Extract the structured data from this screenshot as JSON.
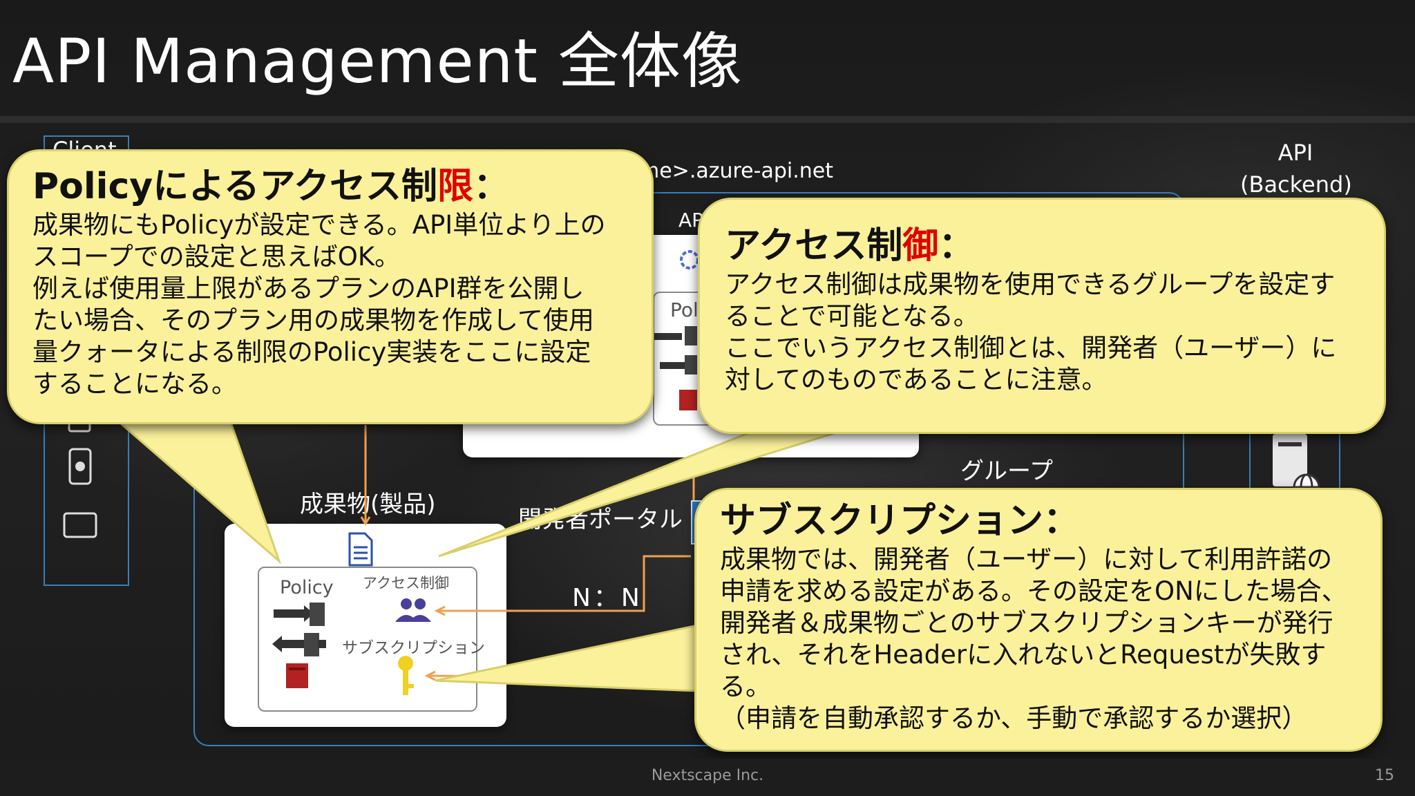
{
  "slide": {
    "title": "API Management 全体像",
    "footer": "Nextscape Inc.",
    "page_number": "15"
  },
  "diagram": {
    "client_label": "Client",
    "url_label": "me>.azure-api.net",
    "api_backend_label": "API\n(Backend)",
    "product_label": "成果物(製品)",
    "policy_label": "Policy",
    "access_control_label": "アクセス制御",
    "subscription_label": "サブスクリプション",
    "dev_portal_label": "開発者ポータル",
    "nn_label": "N：N",
    "group_label": "グループ",
    "api_box_label": "AP",
    "pol_label": "Pol"
  },
  "callouts": {
    "policy": {
      "title": "Policyによるアクセス制",
      "title_red": "限",
      "title_colon": "：",
      "body": "成果物にもPolicyが設定できる。API単位より上の\nスコープでの設定と思えばOK。\n例えば使用量上限があるプランのAPI群を公開し\nたい場合、そのプラン用の成果物を作成して使用\n量クォータによる制限のPolicy実装をここに設定\nすることになる。"
    },
    "access": {
      "title": "アクセス制",
      "title_red": "御",
      "title_colon": "：",
      "body": "アクセス制御は成果物を使用できるグループを設定す\nることで可能となる。\nここでいうアクセス制御とは、開発者（ユーザー）に\n対してのものであることに注意。"
    },
    "subscription": {
      "title": "サブスクリプション：",
      "body": "成果物では、開発者（ユーザー）に対して利用許諾の\n申請を求める設定がある。その設定をONにした場合、\n開発者＆成果物ごとのサブスクリプションキーが発行\nされ、それをHeaderに入れないとRequestが失敗す\nる。\n（申請を自動承認するか、手動で承認するか選択）"
    }
  },
  "colors": {
    "callout_fill": "#fbf19a",
    "accent_red": "#e00000",
    "frame_blue": "#3a7fb8",
    "arrow_orange": "#f0a050"
  },
  "icons": [
    "document-icon",
    "policy-inbound-icon",
    "policy-outbound-icon",
    "policy-error-icon",
    "users-icon",
    "key-icon",
    "gear-icon",
    "tablet-icon",
    "apple-phone-icon",
    "laptop-icon",
    "server-icon",
    "globe-icon"
  ]
}
